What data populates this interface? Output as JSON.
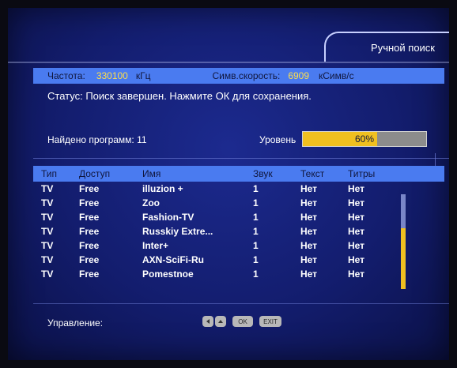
{
  "header": {
    "title": "Ручной поиск"
  },
  "frequency": {
    "freq_label": "Частота:",
    "freq_value": "330100",
    "freq_unit": "кГц",
    "sym_label": "Симв.скорость:",
    "sym_value": "6909",
    "sym_unit": "кСимв/с"
  },
  "status_text": "Статус: Поиск завершен. Нажмите ОК для сохранения.",
  "found_text": "Найдено программ: 11",
  "level": {
    "label": "Уровень",
    "percent": 60,
    "text": "60%"
  },
  "table": {
    "headers": [
      "Тип",
      "Доступ",
      "Имя",
      "Звук",
      "Текст",
      "Титры"
    ],
    "rows": [
      [
        "TV",
        "Free",
        "illuzion +",
        "1",
        "Нет",
        "Нет"
      ],
      [
        "TV",
        "Free",
        "Zoo",
        "1",
        "Нет",
        "Нет"
      ],
      [
        "TV",
        "Free",
        "Fashion-TV",
        "1",
        "Нет",
        "Нет"
      ],
      [
        "TV",
        "Free",
        "Russkiy Extre...",
        "1",
        "Нет",
        "Нет"
      ],
      [
        "TV",
        "Free",
        "Inter+",
        "1",
        "Нет",
        "Нет"
      ],
      [
        "TV",
        "Free",
        "AXN-SciFi-Ru",
        "1",
        "Нет",
        "Нет"
      ],
      [
        "TV",
        "Free",
        "Pomestnoe",
        "1",
        "Нет",
        "Нет"
      ]
    ]
  },
  "scroll": {
    "fraction_visible": 0.64
  },
  "footer": {
    "control_label": "Управление:",
    "ok_label": "OK",
    "exit_label": "EXIT"
  },
  "colors": {
    "accent_bar": "#4a7bf0",
    "highlight": "#f0c020",
    "background": "#131d6e"
  }
}
